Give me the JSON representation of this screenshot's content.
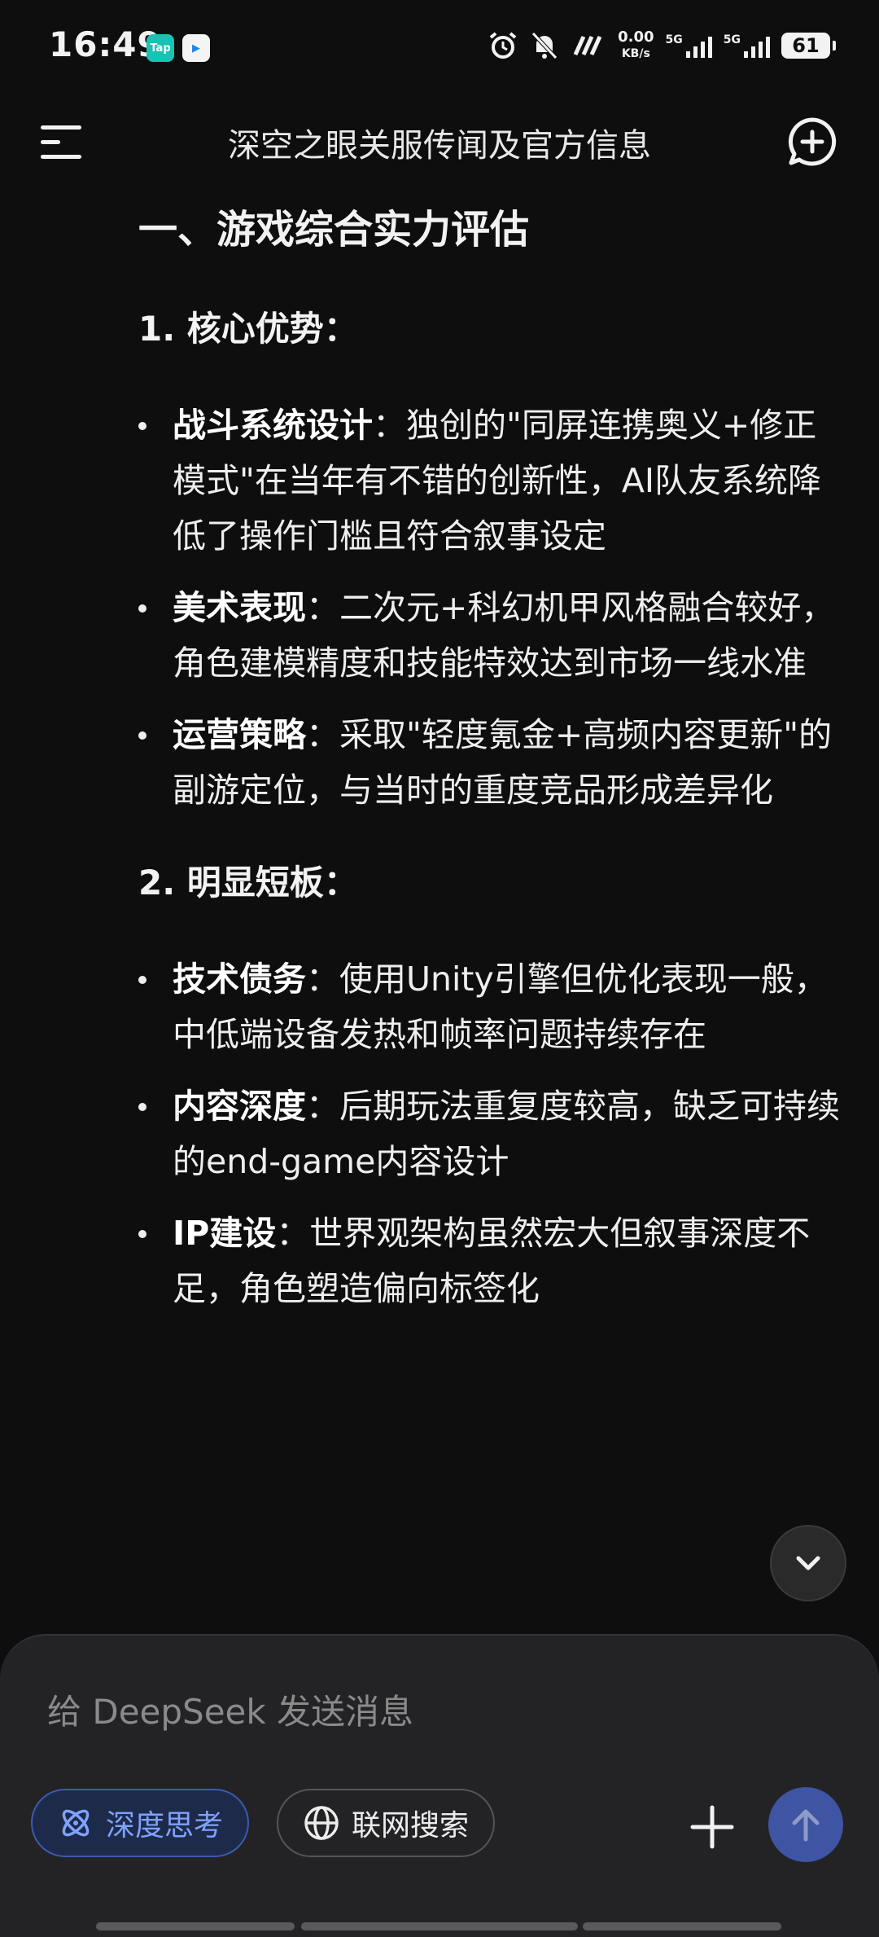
{
  "status": {
    "time": "16:49",
    "tap_badge": "Tap",
    "net_speed_value": "0.00",
    "net_speed_unit": "KB/s",
    "sim1": "5G",
    "sim2": "5G",
    "battery": "61"
  },
  "header": {
    "title": "深空之眼关服传闻及官方信息"
  },
  "content": {
    "section_title": "一、游戏综合实力评估",
    "sub1_title": "1. 核心优势：",
    "sub1_items": [
      {
        "term": "战斗系统设计",
        "text": "：独创的\"同屏连携奥义+修正模式\"在当年有不错的创新性，AI队友系统降低了操作门槛且符合叙事设定"
      },
      {
        "term": "美术表现",
        "text": "：二次元+科幻机甲风格融合较好，角色建模精度和技能特效达到市场一线水准"
      },
      {
        "term": "运营策略",
        "text": "：采取\"轻度氪金+高频内容更新\"的副游定位，与当时的重度竞品形成差异化"
      }
    ],
    "sub2_title": "2. 明显短板：",
    "sub2_items": [
      {
        "term": "技术债务",
        "text": "：使用Unity引擎但优化表现一般，中低端设备发热和帧率问题持续存在"
      },
      {
        "term": "内容深度",
        "text": "：后期玩法重复度较高，缺乏可持续的end-game内容设计"
      },
      {
        "term": "IP建设",
        "text": "：世界观架构虽然宏大但叙事深度不足，角色塑造偏向标签化"
      }
    ]
  },
  "composer": {
    "placeholder": "给 DeepSeek 发送消息",
    "deep_think_label": "深度思考",
    "web_search_label": "联网搜索"
  },
  "colors": {
    "background": "#0e0e0e",
    "accent": "#3f54a3",
    "accent_text": "#7fa2ff"
  },
  "icons": [
    "menu-icon",
    "new-chat-icon",
    "chevron-down-icon",
    "atom-icon",
    "globe-icon",
    "plus-icon",
    "arrow-up-icon",
    "alarm-icon",
    "mute-icon",
    "signal-icon",
    "battery-icon"
  ]
}
